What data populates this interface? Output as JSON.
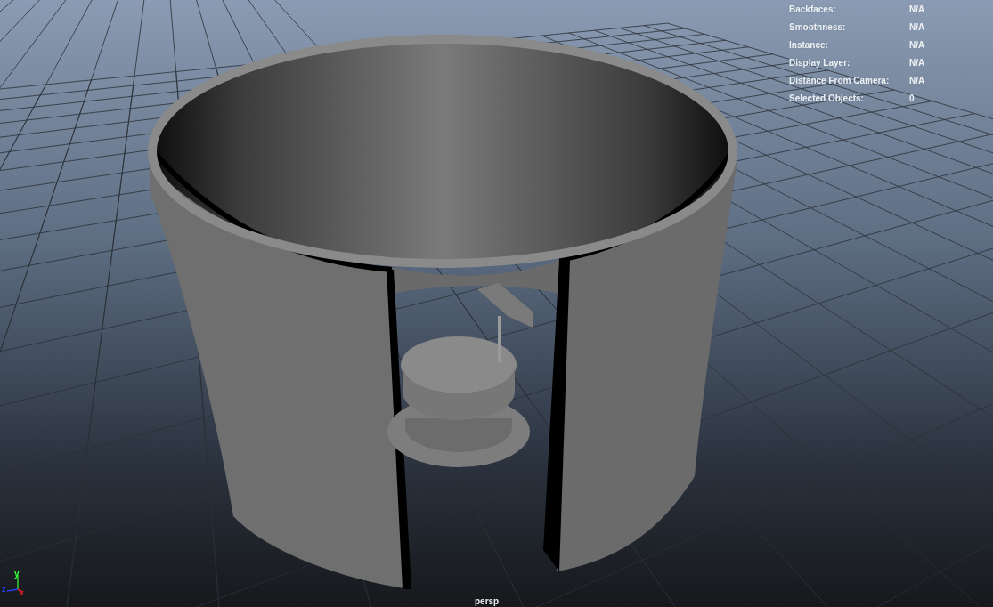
{
  "hud": [
    {
      "label": "Backfaces:",
      "value": "N/A"
    },
    {
      "label": "Smoothness:",
      "value": "N/A"
    },
    {
      "label": "Instance:",
      "value": "N/A"
    },
    {
      "label": "Display Layer:",
      "value": "N/A"
    },
    {
      "label": "Distance From Camera:",
      "value": "N/A"
    },
    {
      "label": "Selected Objects:",
      "value": "0"
    }
  ],
  "axes": {
    "x": "x",
    "y": "y",
    "z": "z"
  },
  "camera": "persp"
}
